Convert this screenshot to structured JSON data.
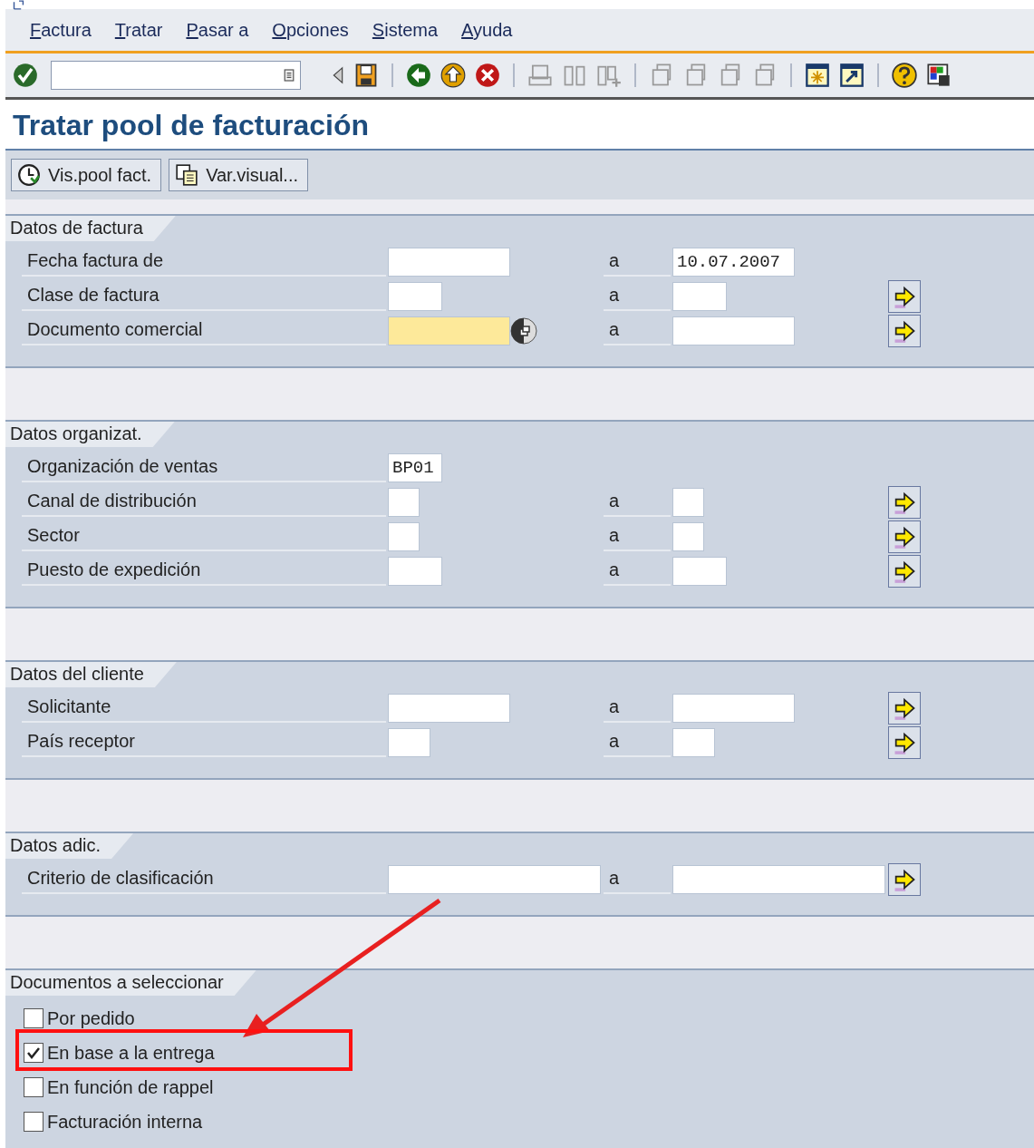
{
  "menu": [
    {
      "label": "Factura"
    },
    {
      "label": "Tratar"
    },
    {
      "label": "Pasar a"
    },
    {
      "label": "Opciones"
    },
    {
      "label": "Sistema"
    },
    {
      "label": "Ayuda"
    }
  ],
  "title": "Tratar pool de facturación",
  "app_toolbar": [
    {
      "label": "Vis.pool fact.",
      "kind": "clock"
    },
    {
      "label": "Var.visual...",
      "kind": "copy"
    }
  ],
  "sections": [
    {
      "title": "Datos de factura",
      "rows": [
        {
          "label": "Fecha factura de",
          "from": {
            "required": false
          },
          "to_label": "a",
          "to": {
            "value": "10.07.2007"
          },
          "multiple": false
        },
        {
          "label": "Clase de factura",
          "from": {
            "required": false
          },
          "to_label": "a",
          "multiple": true
        },
        {
          "label": "Documento comercial",
          "from": {
            "required": true,
            "search_help": true
          },
          "to_label": "a",
          "multiple": true
        }
      ]
    },
    {
      "title": "Datos organizat.",
      "rows": [
        {
          "label": "Organización de ventas",
          "from": {
            "value": "BP01",
            "required": false
          },
          "multiple": false
        },
        {
          "label": "Canal de distribución",
          "from": {
            "required": false
          },
          "to_label": "a",
          "multiple": true
        },
        {
          "label": "Sector",
          "from": {
            "required": false
          },
          "to_label": "a",
          "multiple": true
        },
        {
          "label": "Puesto de expedición",
          "from": {
            "required": false
          },
          "to_label": "a",
          "multiple": true
        }
      ]
    },
    {
      "title": "Datos del cliente",
      "rows": [
        {
          "label": "Solicitante",
          "from": {
            "required": false
          },
          "to_label": "a",
          "multiple": true
        },
        {
          "label": "País receptor",
          "from": {
            "required": false
          },
          "to_label": "a",
          "multiple": true
        }
      ]
    },
    {
      "title": "Datos adic.",
      "rows": [
        {
          "label": "Criterio de clasificación",
          "from": {
            "required": false
          },
          "to_label": "a",
          "multiple": true
        }
      ]
    },
    {
      "title": "Documentos a seleccionar",
      "checkboxes": [
        {
          "label": "Por pedido",
          "checked": false
        },
        {
          "label": "En base a la entrega",
          "checked": true
        },
        {
          "label": "En función de rappel",
          "checked": false
        },
        {
          "label": "Facturación interna",
          "checked": false
        }
      ]
    }
  ]
}
